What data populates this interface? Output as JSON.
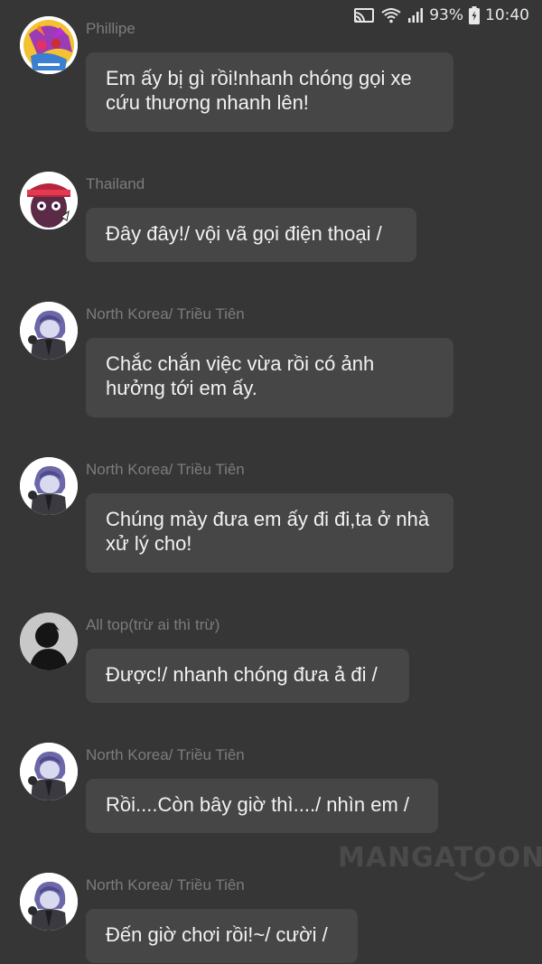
{
  "status": {
    "battery": "93%",
    "time": "10:40"
  },
  "watermark": "MANGATOON",
  "messages": [
    {
      "sender": "Phillipe",
      "text": "Em ấy bị gì rồi!nhanh chóng gọi xe cứu thương nhanh lên!",
      "avatar": "phillipe-avatar"
    },
    {
      "sender": "Thailand",
      "text": "Đây đây!/ vội vã gọi điện thoại /",
      "avatar": "thailand-avatar"
    },
    {
      "sender": "North Korea/ Triều Tiên",
      "text": "Chắc chắn việc vừa rồi có ảnh hưởng tới em ấy.",
      "avatar": "north-korea-avatar"
    },
    {
      "sender": "North Korea/ Triều Tiên",
      "text": "Chúng mày đưa em ấy đi đi,ta ở nhà xử lý cho!",
      "avatar": "north-korea-avatar"
    },
    {
      "sender": "All top(trừ ai thì trừ)",
      "text": "Được!/ nhanh chóng đưa ả đi /",
      "avatar": "silhouette-avatar"
    },
    {
      "sender": "North Korea/ Triều Tiên",
      "text": "Rồi....Còn bây giờ thì..../ nhìn em /",
      "avatar": "north-korea-avatar"
    },
    {
      "sender": "North Korea/ Triều Tiên",
      "text": "Đến giờ chơi rồi!~/ cười /",
      "avatar": "north-korea-avatar"
    }
  ]
}
